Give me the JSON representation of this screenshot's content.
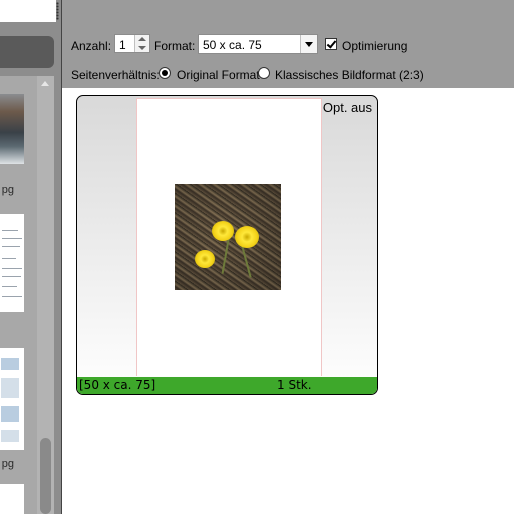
{
  "toolbar": {
    "anzahl_label": "Anzahl:",
    "anzahl_value": "1",
    "format_label": "Format:",
    "format_value": "50 x ca. 75",
    "optimierung_label": "Optimierung",
    "optimierung_checked": true,
    "seitenverhaeltnis_label": "Seitenverhältnis:",
    "radio_options": [
      {
        "label": "Original Format",
        "selected": true
      },
      {
        "label": "Klassisches Bildformat (2:3)",
        "selected": false
      }
    ]
  },
  "preview": {
    "status_text": "Opt. aus",
    "footer_format": "[50 x ca. 75]",
    "footer_count": "1 Stk.",
    "footer_color": "#3ea82b"
  },
  "thumbnails": {
    "captions": [
      "pg",
      "pg"
    ]
  }
}
